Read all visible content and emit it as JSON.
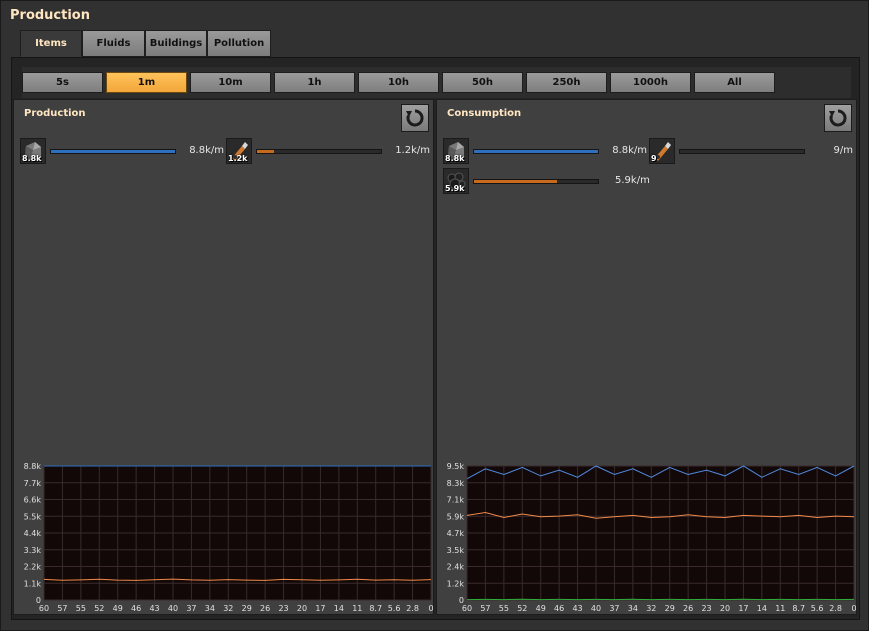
{
  "window": {
    "title": "Production"
  },
  "tabs": [
    {
      "label": "Items",
      "active": true
    },
    {
      "label": "Fluids",
      "active": false
    },
    {
      "label": "Buildings",
      "active": false
    },
    {
      "label": "Pollution",
      "active": false
    }
  ],
  "time_ranges": [
    {
      "label": "5s",
      "active": false
    },
    {
      "label": "1m",
      "active": true
    },
    {
      "label": "10m",
      "active": false
    },
    {
      "label": "1h",
      "active": false
    },
    {
      "label": "10h",
      "active": false
    },
    {
      "label": "50h",
      "active": false
    },
    {
      "label": "250h",
      "active": false
    },
    {
      "label": "1000h",
      "active": false
    },
    {
      "label": "All",
      "active": false
    }
  ],
  "production": {
    "title": "Production",
    "items": [
      {
        "icon": "stone-icon",
        "count": "8.8k",
        "rate": "8.8k/m",
        "fill": 1.0,
        "color": "#2f6fc0"
      },
      {
        "icon": "dynamite-icon",
        "count": "1.2k",
        "rate": "1.2k/m",
        "fill": 0.14,
        "color": "#c86a1e"
      }
    ]
  },
  "consumption": {
    "title": "Consumption",
    "items": [
      {
        "icon": "stone-icon",
        "count": "8.8k",
        "rate": "8.8k/m",
        "fill": 1.0,
        "color": "#2f6fc0"
      },
      {
        "icon": "dynamite-icon",
        "count": "9",
        "rate": "9/m",
        "fill": 0.0,
        "color": "#c86a1e"
      },
      {
        "icon": "coal-icon",
        "count": "5.9k",
        "rate": "5.9k/m",
        "fill": 0.67,
        "color": "#c86a1e"
      }
    ]
  },
  "chart_data": [
    {
      "type": "line",
      "y_ticks": [
        "8.8k",
        "7.7k",
        "6.6k",
        "5.5k",
        "4.4k",
        "3.3k",
        "2.2k",
        "1.1k",
        "0"
      ],
      "x_ticks": [
        "60",
        "57",
        "55",
        "52",
        "49",
        "46",
        "43",
        "40",
        "37",
        "34",
        "32",
        "29",
        "26",
        "23",
        "20",
        "17",
        "14",
        "11",
        "8.7",
        "5.6",
        "2.8",
        "0"
      ],
      "ylim": [
        0,
        8800
      ],
      "xlim": [
        60,
        0
      ],
      "series": [
        {
          "color": "#2f6fc0",
          "values": [
            8800
          ]
        },
        {
          "color": "#f08a4a",
          "values": [
            1350,
            1300,
            1320,
            1360,
            1310,
            1290,
            1330,
            1370,
            1320,
            1300,
            1340,
            1310,
            1290,
            1350,
            1330,
            1300,
            1320,
            1360,
            1310,
            1330,
            1300,
            1340
          ]
        }
      ]
    },
    {
      "type": "line",
      "y_ticks": [
        "9.5k",
        "8.3k",
        "7.1k",
        "5.9k",
        "4.7k",
        "3.5k",
        "2.4k",
        "1.2k",
        "0"
      ],
      "x_ticks": [
        "60",
        "57",
        "55",
        "52",
        "49",
        "46",
        "43",
        "40",
        "37",
        "34",
        "32",
        "29",
        "26",
        "23",
        "20",
        "17",
        "14",
        "11",
        "8.7",
        "5.6",
        "2.8",
        "0"
      ],
      "ylim": [
        0,
        9500
      ],
      "xlim": [
        60,
        0
      ],
      "series": [
        {
          "color": "#4f8ae0",
          "values": [
            8600,
            9300,
            8900,
            9400,
            8800,
            9200,
            8700,
            9500,
            8900,
            9300,
            8700,
            9400,
            8900,
            9200,
            8800,
            9500,
            8700,
            9300,
            8900,
            9400,
            8800,
            9500
          ]
        },
        {
          "color": "#f08a4a",
          "values": [
            6000,
            6200,
            5850,
            6100,
            5900,
            5950,
            6050,
            5800,
            5900,
            6000,
            5850,
            5900,
            6050,
            5900,
            5850,
            6000,
            5950,
            5900,
            6000,
            5850,
            5950,
            5900
          ]
        },
        {
          "color": "#2fae3a",
          "values": [
            30,
            40,
            30,
            50,
            30,
            40,
            30,
            40,
            30,
            50,
            30,
            40,
            30,
            40,
            30,
            50,
            30,
            40,
            30,
            40,
            30,
            40
          ]
        }
      ]
    }
  ]
}
